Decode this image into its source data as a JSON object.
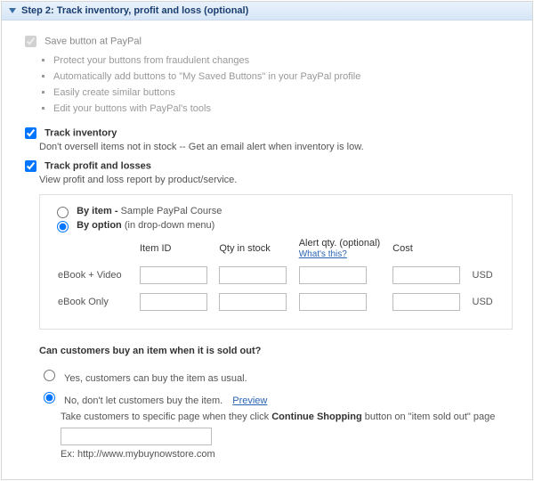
{
  "header": {
    "title": "Step 2: Track inventory, profit and loss (optional)"
  },
  "save": {
    "label": "Save button at PayPal",
    "bullets": [
      "Protect your buttons from fraudulent changes",
      "Automatically add buttons to \"My Saved Buttons\" in your PayPal profile",
      "Easily create similar buttons",
      "Edit your buttons with PayPal's tools"
    ]
  },
  "track_inventory": {
    "label": "Track inventory",
    "desc": "Don't oversell items not in stock -- Get an email alert when inventory is low."
  },
  "track_pl": {
    "label": "Track profit and losses",
    "desc": "View profit and loss report by product/service."
  },
  "tracking": {
    "by_item_label": "By item -",
    "by_item_example": " Sample PayPal Course",
    "by_option_label": "By option",
    "by_option_hint": " (in drop-down menu)",
    "cols": {
      "item_id": "Item ID",
      "qty": "Qty in stock",
      "alert": "Alert qty. (optional)",
      "cost": "Cost"
    },
    "whats_this": "What's this?",
    "rows": [
      {
        "name": "eBook + Video",
        "currency": "USD"
      },
      {
        "name": "eBook Only",
        "currency": "USD"
      }
    ]
  },
  "soldout": {
    "question": "Can customers buy an item when it is sold out?",
    "yes": "Yes, customers can buy the item as usual.",
    "no": "No, don't let customers buy the item.",
    "preview": "Preview",
    "take_pre": "Take customers to specific page when they click ",
    "continue": "Continue Shopping",
    "take_post": " button on \"item sold out\" page",
    "example": "Ex: http://www.mybuynowstore.com"
  }
}
